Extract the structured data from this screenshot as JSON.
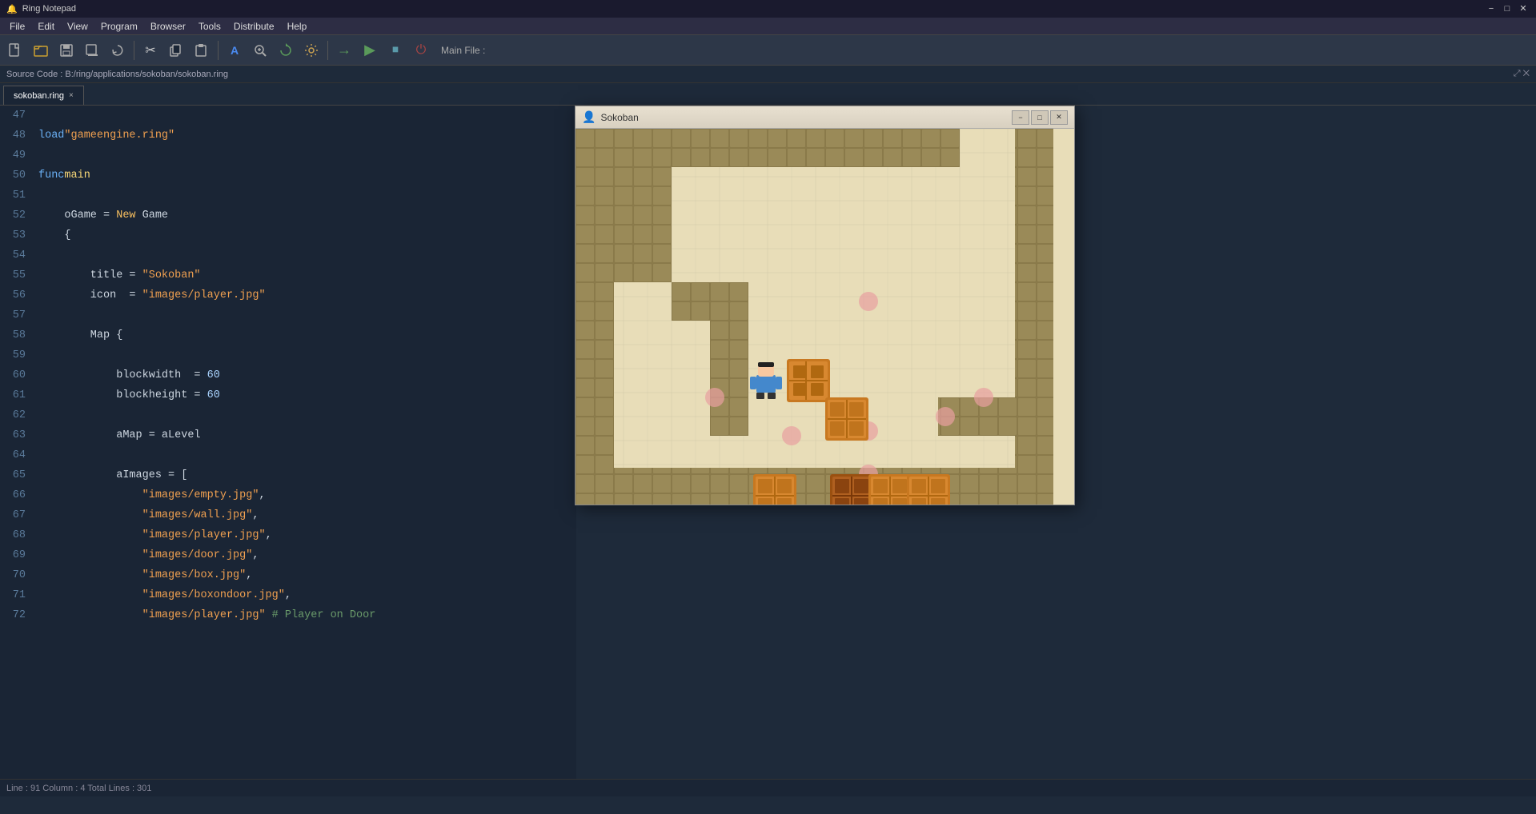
{
  "titlebar": {
    "icon": "🔔",
    "title": "Ring Notepad",
    "min": "−",
    "max": "□",
    "close": "✕"
  },
  "menubar": {
    "items": [
      "File",
      "Edit",
      "View",
      "Program",
      "Browser",
      "Tools",
      "Distribute",
      "Help"
    ]
  },
  "toolbar": {
    "buttons": [
      {
        "name": "new",
        "icon": "📄"
      },
      {
        "name": "open",
        "icon": "📂"
      },
      {
        "name": "save",
        "icon": "💾"
      },
      {
        "name": "save-all",
        "icon": "💾"
      },
      {
        "name": "reload",
        "icon": "↩"
      },
      {
        "name": "cut",
        "icon": "✂"
      },
      {
        "name": "copy",
        "icon": "📋"
      },
      {
        "name": "paste",
        "icon": "📌"
      },
      {
        "name": "find",
        "icon": "A"
      },
      {
        "name": "zoom",
        "icon": "🔍"
      },
      {
        "name": "refresh",
        "icon": "🔄"
      },
      {
        "name": "settings",
        "icon": "⚙"
      },
      {
        "name": "back",
        "icon": "→"
      },
      {
        "name": "run",
        "icon": "▶"
      },
      {
        "name": "stop",
        "icon": "⏹"
      },
      {
        "name": "distribute",
        "icon": "⊕"
      }
    ],
    "main_file_label": "Main File :"
  },
  "source_path": "Source Code : B:/ring/applications/sokoban/sokoban.ring",
  "tab": {
    "filename": "sokoban.ring",
    "close": "×"
  },
  "code": {
    "lines": [
      {
        "num": 47,
        "content": ""
      },
      {
        "num": 48,
        "content": "load \"gameengine.ring\""
      },
      {
        "num": 49,
        "content": ""
      },
      {
        "num": 50,
        "content": "func main"
      },
      {
        "num": 51,
        "content": ""
      },
      {
        "num": 52,
        "content": "    oGame = New Game"
      },
      {
        "num": 53,
        "content": "    {"
      },
      {
        "num": 54,
        "content": ""
      },
      {
        "num": 55,
        "content": "        title = \"Sokoban\""
      },
      {
        "num": 56,
        "content": "        icon  = \"images/player.jpg\""
      },
      {
        "num": 57,
        "content": ""
      },
      {
        "num": 58,
        "content": "        Map {"
      },
      {
        "num": 59,
        "content": ""
      },
      {
        "num": 60,
        "content": "            blockwidth  = 60"
      },
      {
        "num": 61,
        "content": "            blockheight = 60"
      },
      {
        "num": 62,
        "content": ""
      },
      {
        "num": 63,
        "content": "            aMap = aLevel"
      },
      {
        "num": 64,
        "content": ""
      },
      {
        "num": 65,
        "content": "            aImages = ["
      },
      {
        "num": 66,
        "content": "                \"images/empty.jpg\","
      },
      {
        "num": 67,
        "content": "                \"images/wall.jpg\","
      },
      {
        "num": 68,
        "content": "                \"images/player.jpg\","
      },
      {
        "num": 69,
        "content": "                \"images/door.jpg\","
      },
      {
        "num": 70,
        "content": "                \"images/box.jpg\","
      },
      {
        "num": 71,
        "content": "                \"images/boxondoor.jpg\","
      },
      {
        "num": 72,
        "content": "                \"images/player.jpg\" # Player on Door"
      }
    ]
  },
  "game_window": {
    "title": "Sokoban",
    "icon": "👤"
  },
  "status_bar": {
    "text": "Line : 91  Column : 4  Total Lines : 301"
  }
}
